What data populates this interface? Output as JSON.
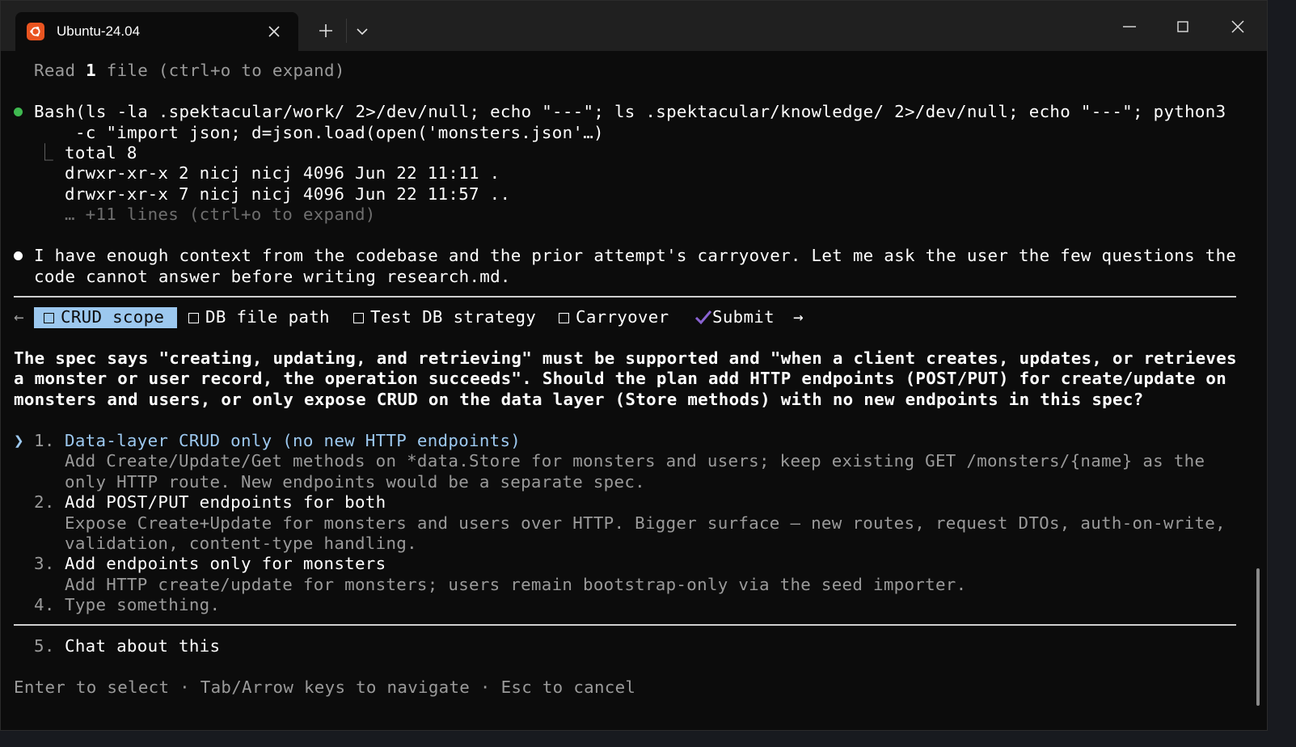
{
  "window": {
    "tab_title": "Ubuntu-24.04"
  },
  "terminal": {
    "read_line": {
      "prefix": "Read ",
      "count": "1",
      "suffix": " file (ctrl+o to expand)"
    },
    "bash": {
      "line1": "Bash(ls -la .spektacular/work/ 2>/dev/null; echo \"---\"; ls .spektacular/knowledge/ 2>/dev/null; echo \"---\"; python3",
      "line2": "-c \"import json; d=json.load(open('monsters.json'…)",
      "branch": "⎿",
      "out1": "total 8",
      "out2": "drwxr-xr-x 2 nicj nicj 4096 Jun 22 11:11 .",
      "out3": "drwxr-xr-x 7 nicj nicj 4096 Jun 22 11:57 ..",
      "more": "… +11 lines (ctrl+o to expand)"
    },
    "message": {
      "line1": "I have enough context from the codebase and the prior attempt's carryover. Let me ask the user the few questions the",
      "line2": "code cannot answer before writing research.md."
    },
    "tabs_nav": {
      "left_arrow": "←",
      "right_arrow": "→",
      "items": [
        {
          "label": "CRUD scope"
        },
        {
          "label": "DB file path"
        },
        {
          "label": "Test DB strategy"
        },
        {
          "label": "Carryover"
        }
      ],
      "submit": "Submit"
    },
    "question": {
      "line1": "The spec says \"creating, updating, and retrieving\" must be supported and \"when a client creates, updates, or retrieves",
      "line2": "a monster or user record, the operation succeeds\". Should the plan add HTTP endpoints (POST/PUT) for create/update on",
      "line3": "monsters and users, or only expose CRUD on the data layer (Store methods) with no new endpoints in this spec?"
    },
    "options": [
      {
        "number": "1.",
        "label": "Data-layer CRUD only (no new HTTP endpoints)",
        "desc1": "Add Create/Update/Get methods on *data.Store for monsters and users; keep existing GET /monsters/{name} as the",
        "desc2": "only HTTP route. New endpoints would be a separate spec."
      },
      {
        "number": "2.",
        "label": "Add POST/PUT endpoints for both",
        "desc1": "Expose Create+Update for monsters and users over HTTP. Bigger surface — new routes, request DTOs, auth-on-write,",
        "desc2": "validation, content-type handling."
      },
      {
        "number": "3.",
        "label": "Add endpoints only for monsters",
        "desc1": "Add HTTP create/update for monsters; users remain bootstrap-only via the seed importer."
      },
      {
        "number": "4.",
        "label": "Type something."
      }
    ],
    "selector": "❯",
    "chat_option": {
      "number": "5.",
      "label": "Chat about this"
    },
    "footer": "Enter to select · Tab/Arrow keys to navigate · Esc to cancel"
  },
  "colors": {
    "background": "#0c0c0c",
    "titlebar": "#202020",
    "accent": "#9cc8ef",
    "ubuntu_orange": "#e95420",
    "green_dot": "#3fb950",
    "submit_check": "#8a63d2"
  }
}
